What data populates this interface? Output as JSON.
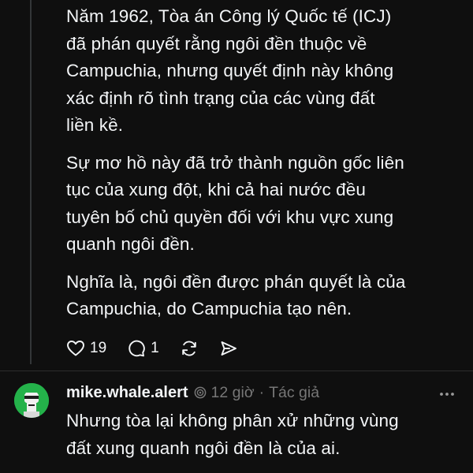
{
  "post": {
    "paragraphs": [
      "Năm 1962, Tòa án Công lý Quốc tế (ICJ)\nđã phán quyết rằng ngôi đền thuộc về\nCampuchia, nhưng quyết định này không\nxác định rõ tình trạng của các vùng đất\nliền kề.",
      "Sự mơ hồ này đã trở thành nguồn gốc liên\ntục của xung đột, khi cả hai nước đều\ntuyên bố chủ quyền đối với khu vực xung\nquanh ngôi đền.",
      "Nghĩa là, ngôi đền được phán quyết là của\nCampuchia, do Campuchia tạo nên."
    ],
    "actions": {
      "like_count": "19",
      "reply_count": "1"
    }
  },
  "reply": {
    "username": "mike.whale.alert",
    "time": "12 giờ",
    "separator": "·",
    "role": "Tác giả",
    "text": "Nhưng tòa lại không phân xử những vùng\nđất xung quanh ngôi đền là của ai."
  },
  "colors": {
    "background": "#0f0f0f",
    "text": "#f3f5f7",
    "muted": "#777777",
    "avatar": "#24b24a"
  },
  "icons": {
    "like": "heart-icon",
    "reply": "comment-icon",
    "repost": "repost-icon",
    "share": "send-icon",
    "verified": "verified-icon",
    "more": "more-icon"
  }
}
